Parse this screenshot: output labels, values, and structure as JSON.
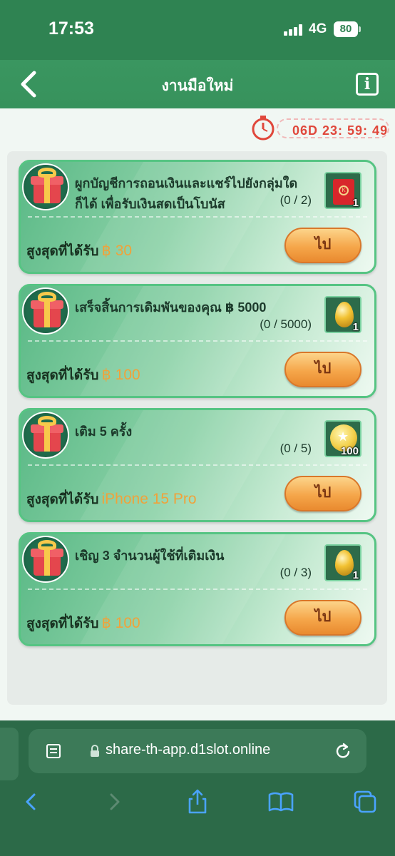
{
  "status": {
    "time": "17:53",
    "network": "4G",
    "battery": "80"
  },
  "header": {
    "title": "งานมือใหม่",
    "info_label": "i"
  },
  "timer": {
    "text": "06D 23: 59: 49"
  },
  "tasks": [
    {
      "description": "ผูกบัญชีการถอนเงินและแชร์ไปยังกลุ่มใดก็ได้ เพื่อรับเงินสดเป็นโบนัส",
      "progress": "(0 / 2)",
      "reward_count": "1",
      "reward_icon": "red-envelope-icon",
      "max_label": "สูงสุดที่ได้รับ",
      "amount": "฿ 30",
      "button": "ไป"
    },
    {
      "description": "เสร็จสิ้นการเดิมพันของคุณ ฿ 5000",
      "progress": "(0 / 5000)",
      "reward_count": "1",
      "reward_icon": "golden-egg-icon",
      "max_label": "สูงสุดที่ได้รับ",
      "amount": "฿ 100",
      "button": "ไป"
    },
    {
      "description": "เติม 5 ครั้ง",
      "progress": "(0 / 5)",
      "reward_count": "100",
      "reward_icon": "star-coin-icon",
      "max_label": "สูงสุดที่ได้รับ",
      "amount": "iPhone 15 Pro",
      "button": "ไป"
    },
    {
      "description": "เชิญ 3 จำนวนผู้ใช้ที่เติมเงิน",
      "progress": "(0 / 3)",
      "reward_count": "1",
      "reward_icon": "golden-egg-icon",
      "max_label": "สูงสุดที่ได้รับ",
      "amount": "฿ 100",
      "button": "ไป"
    }
  ],
  "browser": {
    "url": "share-th-app.d1slot.online"
  },
  "colors": {
    "header_green": "#37925c",
    "button_orange": "#f5a64a",
    "amount_orange": "#f0a23a",
    "timer_red": "#e0473b"
  }
}
